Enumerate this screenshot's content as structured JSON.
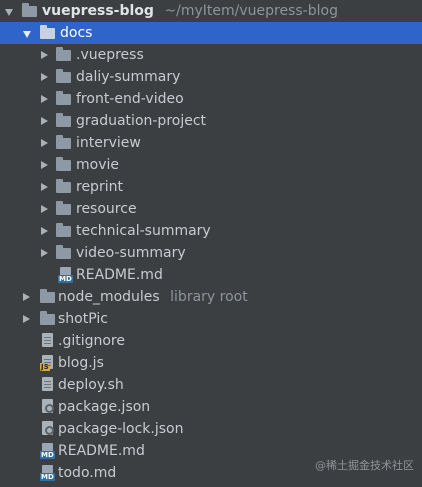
{
  "project": {
    "name": "vuepress-blog",
    "path": "~/myItem/vuepress-blog"
  },
  "docs": {
    "label": "docs",
    "children": [
      {
        "label": ".vuepress"
      },
      {
        "label": "daliy-summary"
      },
      {
        "label": "front-end-video"
      },
      {
        "label": "graduation-project"
      },
      {
        "label": "interview"
      },
      {
        "label": "movie"
      },
      {
        "label": "reprint"
      },
      {
        "label": "resource"
      },
      {
        "label": "technical-summary"
      },
      {
        "label": "video-summary"
      }
    ],
    "readme": "README.md"
  },
  "root_items": {
    "node_modules": "node_modules",
    "node_modules_hint": "library root",
    "shotPic": "shotPic",
    "gitignore": ".gitignore",
    "blog_js": "blog.js",
    "deploy_sh": "deploy.sh",
    "package_json": "package.json",
    "package_lock_json": "package-lock.json",
    "readme": "README.md",
    "todo": "todo.md"
  },
  "watermark": "@稀土掘金技术社区",
  "colors": {
    "background": "#3c3f41",
    "selection": "#2f65ca",
    "text": "#c8ccd0"
  }
}
